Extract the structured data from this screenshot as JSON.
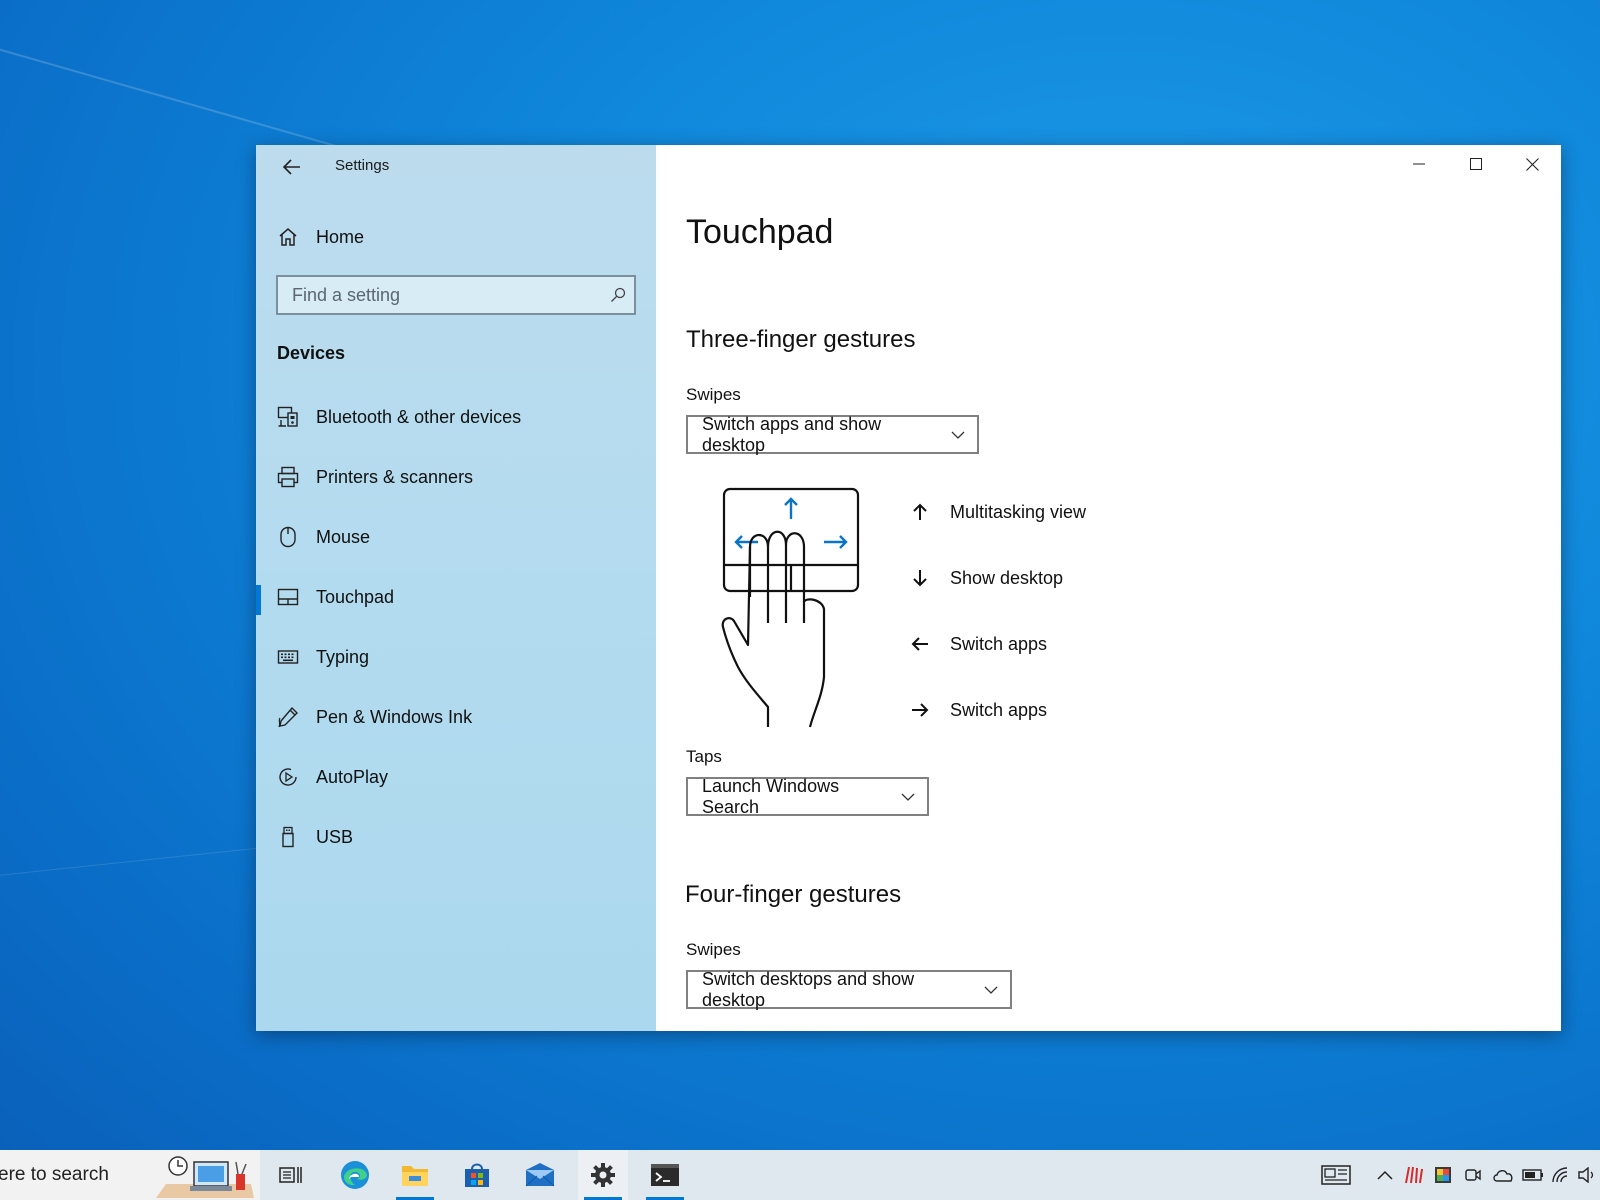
{
  "app": {
    "title": "Settings"
  },
  "sidebar": {
    "home_label": "Home",
    "search_placeholder": "Find a setting",
    "section_title": "Devices",
    "items": [
      {
        "label": "Bluetooth & other devices",
        "icon": "bluetooth-devices-icon"
      },
      {
        "label": "Printers & scanners",
        "icon": "printer-icon"
      },
      {
        "label": "Mouse",
        "icon": "mouse-icon"
      },
      {
        "label": "Touchpad",
        "icon": "touchpad-icon",
        "selected": true
      },
      {
        "label": "Typing",
        "icon": "keyboard-icon"
      },
      {
        "label": "Pen & Windows Ink",
        "icon": "pen-icon"
      },
      {
        "label": "AutoPlay",
        "icon": "autoplay-icon"
      },
      {
        "label": "USB",
        "icon": "usb-icon"
      }
    ]
  },
  "main": {
    "page_title": "Touchpad",
    "three_finger": {
      "heading": "Three-finger gestures",
      "swipes_label": "Swipes",
      "swipes_value": "Switch apps and show desktop",
      "gestures": [
        {
          "direction": "up",
          "label": "Multitasking view"
        },
        {
          "direction": "down",
          "label": "Show desktop"
        },
        {
          "direction": "left",
          "label": "Switch apps"
        },
        {
          "direction": "right",
          "label": "Switch apps"
        }
      ],
      "taps_label": "Taps",
      "taps_value": "Launch Windows Search"
    },
    "four_finger": {
      "heading": "Four-finger gestures",
      "swipes_label": "Swipes",
      "swipes_value": "Switch desktops and show desktop"
    }
  },
  "taskbar": {
    "search_text": "ere to search",
    "pinned": [
      "task-view-icon",
      "edge-icon",
      "file-explorer-icon",
      "store-icon",
      "mail-icon",
      "settings-icon",
      "terminal-icon"
    ],
    "tray": [
      "news-icon",
      "chevron-up-icon",
      "app-tray-icon",
      "color-app-icon",
      "meet-icon",
      "onedrive-icon",
      "battery-icon",
      "wifi-icon",
      "volume-icon"
    ]
  },
  "colors": {
    "accent": "#0078d4",
    "sidebar_bg": "#b3dbef",
    "desktop": "#0f86da"
  }
}
